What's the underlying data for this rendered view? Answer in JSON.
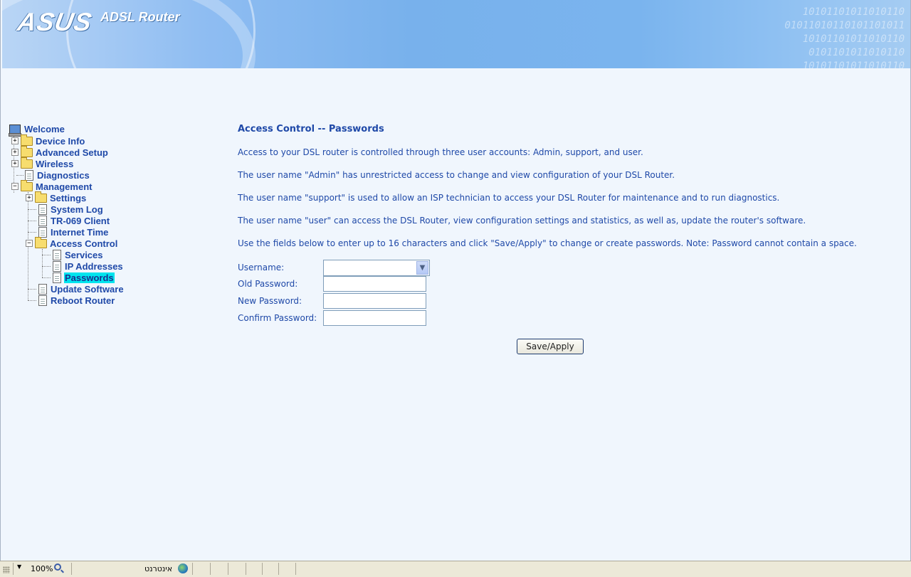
{
  "header": {
    "logo_text": "ASUS",
    "product": "ADSL Router"
  },
  "tree": {
    "welcome": "Welcome",
    "device_info": "Device Info",
    "advanced_setup": "Advanced Setup",
    "wireless": "Wireless",
    "diagnostics": "Diagnostics",
    "management": "Management",
    "settings": "Settings",
    "system_log": "System Log",
    "tr069": "TR-069 Client",
    "internet_time": "Internet Time",
    "access_control": "Access Control",
    "services": "Services",
    "ip_addresses": "IP Addresses",
    "passwords": "Passwords",
    "update_software": "Update Software",
    "reboot_router": "Reboot Router",
    "expand_glyph": "+",
    "collapse_glyph": "−"
  },
  "main": {
    "title": "Access Control -- Passwords",
    "paragraphs": [
      "Access to your DSL router is controlled through three user accounts: Admin, support, and user.",
      "The user name \"Admin\" has unrestricted access to change and view configuration of your DSL Router.",
      "The user name \"support\" is used to allow an ISP technician to access your DSL Router for maintenance and to run diagnostics.",
      "The user name \"user\" can access the DSL Router, view configuration settings and statistics, as well as, update the router's software.",
      "Use the fields below to enter up to 16 characters and click \"Save/Apply\" to change or create passwords. Note: Password cannot contain a space."
    ],
    "form": {
      "username_label": "Username:",
      "username_value": "",
      "old_password_label": "Old Password:",
      "new_password_label": "New Password:",
      "confirm_password_label": "Confirm Password:",
      "save_label": "Save/Apply"
    }
  },
  "status_bar": {
    "zoom": "100%",
    "zone": "אינטרנט"
  },
  "colors": {
    "link": "#1f49a8",
    "selected_bg": "#00e4ee",
    "page_bg": "#f0f6fd"
  }
}
